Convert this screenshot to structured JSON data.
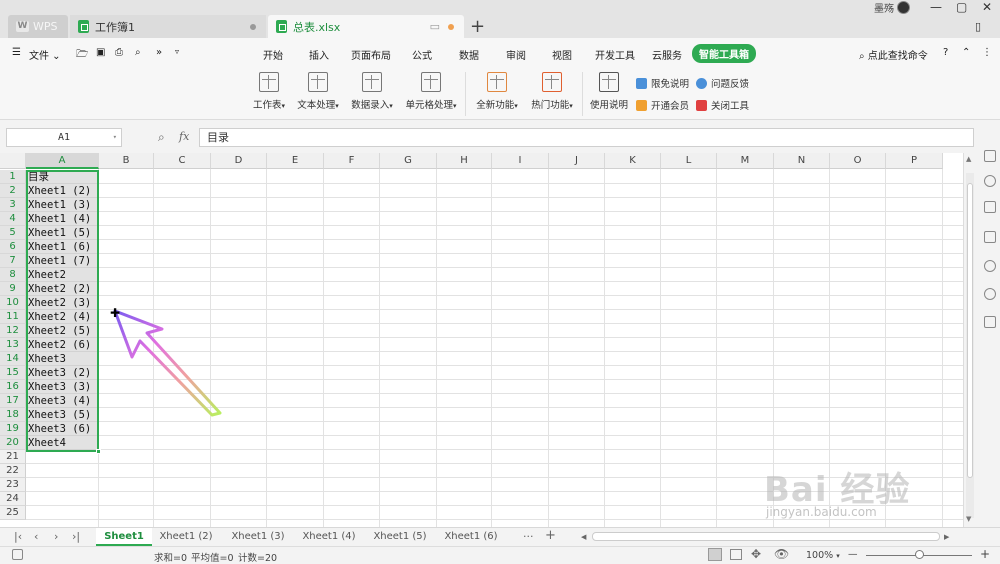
{
  "titlebar": {
    "wps_tab": "WPS",
    "tab1_label": "工作簿1",
    "tab2_label": "总表.xlsx",
    "new_tab": "+",
    "user_name": "墨殇",
    "min_icon": "minimize-icon",
    "max_icon": "maximize-icon",
    "close_icon": "close-icon"
  },
  "menubar": {
    "file_label": "文件",
    "tabs": [
      "开始",
      "插入",
      "页面布局",
      "公式",
      "数据",
      "审阅",
      "视图",
      "开发工具",
      "云服务",
      "智能工具箱"
    ],
    "active_tab": "智能工具箱",
    "search_label": "点此查找命令",
    "help": "?",
    "more": "»",
    "accent": "#2eaa52"
  },
  "ribbon": {
    "buttons": [
      "工作表",
      "文本处理",
      "数据录入",
      "单元格处理",
      "全新功能",
      "热门功能",
      "使用说明"
    ],
    "links": [
      "限免说明",
      "问题反馈",
      "开通会员",
      "关闭工具"
    ]
  },
  "formula_bar": {
    "cell_ref": "A1",
    "fx_label": "fx",
    "value": "目录"
  },
  "grid": {
    "columns": [
      "A",
      "B",
      "C",
      "D",
      "E",
      "F",
      "G",
      "H",
      "I",
      "J",
      "K",
      "L",
      "M",
      "N",
      "O",
      "P"
    ],
    "rows": [
      "1",
      "2",
      "3",
      "4",
      "5",
      "6",
      "7",
      "8",
      "9",
      "10",
      "11",
      "12",
      "13",
      "14",
      "15",
      "16",
      "17",
      "18",
      "19",
      "20",
      "21",
      "22",
      "23",
      "24",
      "25"
    ],
    "column_a": [
      "目录",
      "Xheet1 (2)",
      "Xheet1 (3)",
      "Xheet1 (4)",
      "Xheet1 (5)",
      "Xheet1 (6)",
      "Xheet1 (7)",
      "Xheet2",
      "Xheet2 (2)",
      "Xheet2 (3)",
      "Xheet2 (4)",
      "Xheet2 (5)",
      "Xheet2 (6)",
      "Xheet3",
      "Xheet3 (2)",
      "Xheet3 (3)",
      "Xheet3 (4)",
      "Xheet3 (5)",
      "Xheet3 (6)",
      "Xheet4"
    ]
  },
  "sheet_tabs": {
    "tabs": [
      "Sheet1",
      "Xheet1 (2)",
      "Xheet1 (3)",
      "Xheet1 (4)",
      "Xheet1 (5)",
      "Xheet1 (6)"
    ],
    "active": "Sheet1",
    "more": "···",
    "add": "+"
  },
  "statusbar": {
    "sum": "求和=0",
    "avg": "平均值=0",
    "count": "计数=20",
    "zoom": "100%",
    "zoom_minus": "—",
    "zoom_plus": "+"
  },
  "watermark": {
    "text": "Bai 经验",
    "sub": "jingyan.baidu.com"
  }
}
